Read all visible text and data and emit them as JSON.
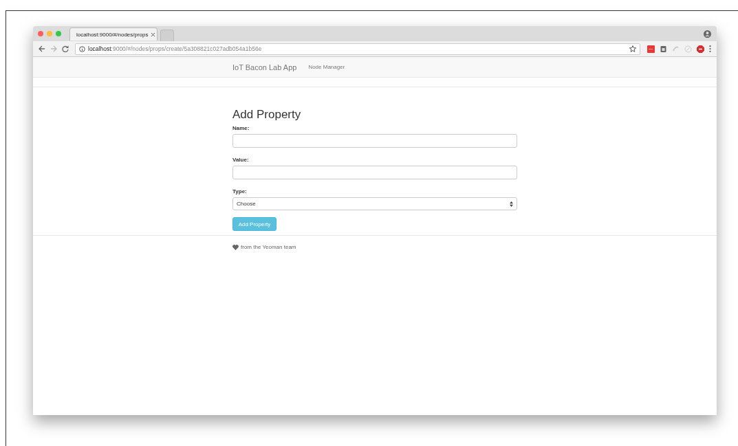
{
  "browser": {
    "tabs": [
      {
        "title": "localhost:9000/#/nodes/props",
        "selected": true
      },
      {
        "selected": false
      }
    ],
    "address": {
      "host": "localhost",
      "path": ":9000/#/nodes/props/create/5a308821c027adb054a1b56e"
    }
  },
  "navbar": {
    "brand": "IoT Bacon Lab App",
    "links": [
      "Node Manager"
    ]
  },
  "form": {
    "title": "Add Property",
    "fields": [
      {
        "kind": "text",
        "label": "Name:"
      },
      {
        "kind": "text",
        "label": "Value:"
      },
      {
        "kind": "select",
        "label": "Type:",
        "value": "Choose"
      }
    ],
    "submit": "Add Property"
  },
  "footer": {
    "text": "from the Yeoman team"
  }
}
